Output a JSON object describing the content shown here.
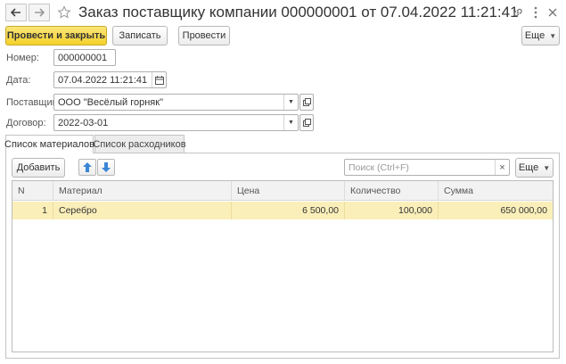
{
  "window": {
    "title": "Заказ поставщику компании 000000001 от 07.04.2022 11:21:41"
  },
  "toolbar": {
    "post_and_close": "Провести и закрыть",
    "save": "Записать",
    "post": "Провести",
    "more": "Еще"
  },
  "form": {
    "number": {
      "label": "Номер:",
      "value": "000000001"
    },
    "date": {
      "label": "Дата:",
      "value": "07.04.2022 11:21:41"
    },
    "supplier": {
      "label": "Поставщик:",
      "value": "ООО \"Весёлый горняк\""
    },
    "contract": {
      "label": "Договор:",
      "value": "2022-03-01"
    }
  },
  "tabs": [
    {
      "label": "Список материалов",
      "active": true
    },
    {
      "label": "Список расходников",
      "active": false
    }
  ],
  "table_toolbar": {
    "add": "Добавить",
    "search_placeholder": "Поиск (Ctrl+F)",
    "more": "Еще"
  },
  "table": {
    "columns": [
      "N",
      "Материал",
      "Цена",
      "Количество",
      "Сумма"
    ],
    "rows": [
      {
        "n": "1",
        "material": "Серебро",
        "price": "6 500,00",
        "quantity": "100,000",
        "sum": "650 000,00"
      }
    ]
  },
  "colors": {
    "primary_button": "#f4d12a",
    "selected_row": "#fbefb9",
    "arrow_icon": "#3a86d6"
  }
}
